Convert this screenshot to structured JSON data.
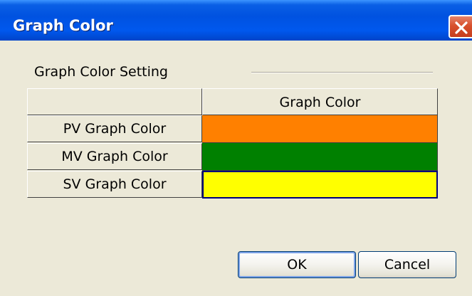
{
  "window": {
    "title": "Graph Color"
  },
  "titlebar": {
    "close_icon": "close-icon"
  },
  "group": {
    "label": "Graph Color Setting"
  },
  "table": {
    "column_header": "Graph Color",
    "rows": [
      {
        "label": "PV Graph Color",
        "color": "#ff8000"
      },
      {
        "label": "MV Graph Color",
        "color": "#008000"
      },
      {
        "label": "SV Graph Color",
        "color": "#ffff00"
      }
    ]
  },
  "buttons": {
    "ok_label": "OK",
    "cancel_label": "Cancel"
  }
}
